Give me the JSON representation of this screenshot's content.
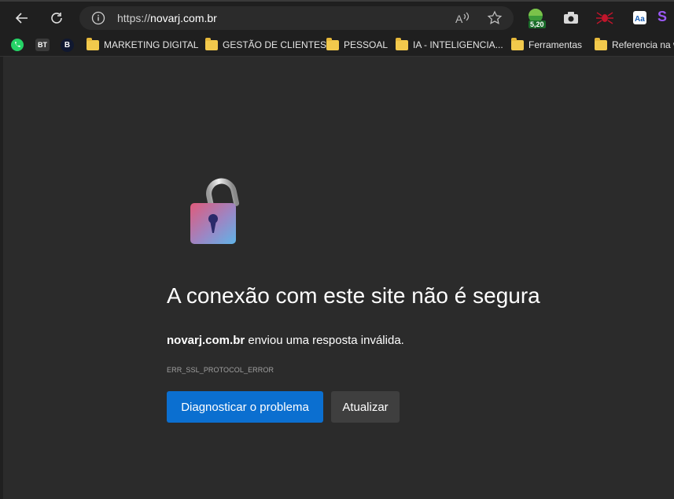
{
  "toolbar": {
    "url_scheme": "https://",
    "url_host": "novarj.com.br",
    "extension_badge": "5,20",
    "extension_s": "S"
  },
  "bookmarks": [
    {
      "label": "",
      "icon": "whatsapp-icon"
    },
    {
      "label": "BT",
      "icon": "bt-icon"
    },
    {
      "label": "B",
      "icon": "b-icon"
    },
    {
      "label": "MARKETING DIGITAL",
      "icon": "folder-icon"
    },
    {
      "label": "GESTÃO DE CLIENTES",
      "icon": "folder-icon"
    },
    {
      "label": "PESSOAL",
      "icon": "folder-icon"
    },
    {
      "label": "IA - INTELIGENCIA...",
      "icon": "folder-icon"
    },
    {
      "label": "Ferramentas",
      "icon": "folder-icon"
    },
    {
      "label": "Referencia na w",
      "icon": "folder-icon"
    }
  ],
  "error_page": {
    "title": "A conexão com este site não é segura",
    "host": "novarj.com.br",
    "message": "enviou uma resposta inválida.",
    "error_code": "ERR_SSL_PROTOCOL_ERROR",
    "diagnose_button": "Diagnosticar o problema",
    "refresh_button": "Atualizar"
  },
  "colors": {
    "primary_button": "#0b6fd0",
    "secondary_button": "#3f3f3f",
    "page_bg": "#2b2b2b"
  }
}
